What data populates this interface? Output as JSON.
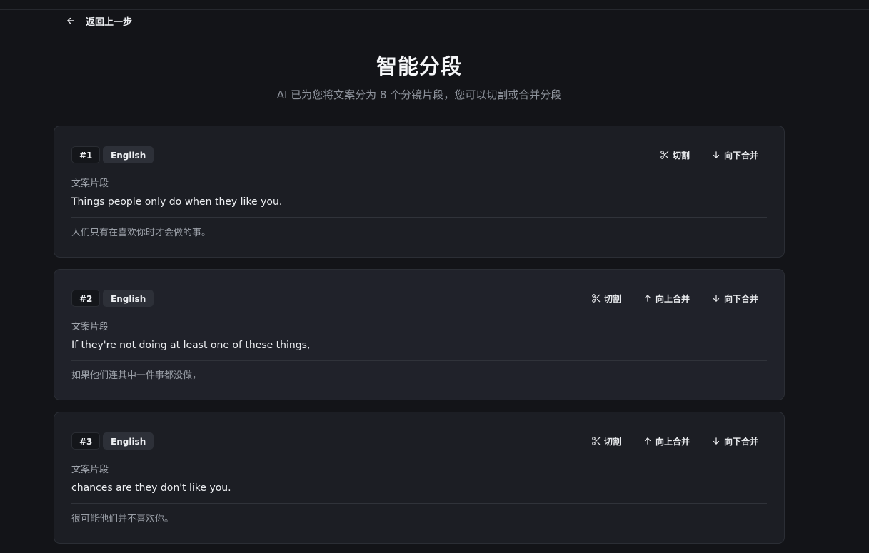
{
  "nav": {
    "back_label": "返回上一步"
  },
  "header": {
    "title": "智能分段",
    "subtitle": "AI 已为您将文案分为 8 个分镜片段，您可以切割或合并分段"
  },
  "segments": [
    {
      "number": "#1",
      "language": "English",
      "label": "文案片段",
      "text": "Things people only do when they like you.",
      "translation": "人们只有在喜欢你时才会做的事。",
      "actions": {
        "cut": "切割",
        "merge_down": "向下合并"
      }
    },
    {
      "number": "#2",
      "language": "English",
      "label": "文案片段",
      "text": "If they're not doing at least one of these things,",
      "translation": "如果他们连其中一件事都没做，",
      "actions": {
        "cut": "切割",
        "merge_up": "向上合并",
        "merge_down": "向下合并"
      }
    },
    {
      "number": "#3",
      "language": "English",
      "label": "文案片段",
      "text": "chances are they don't like you.",
      "translation": "很可能他们并不喜欢你。",
      "actions": {
        "cut": "切割",
        "merge_up": "向上合并",
        "merge_down": "向下合并"
      }
    }
  ],
  "icons": {
    "back": "arrow-left-icon",
    "cut": "scissors-icon",
    "merge_up": "arrow-up-icon",
    "merge_down": "arrow-down-icon"
  }
}
